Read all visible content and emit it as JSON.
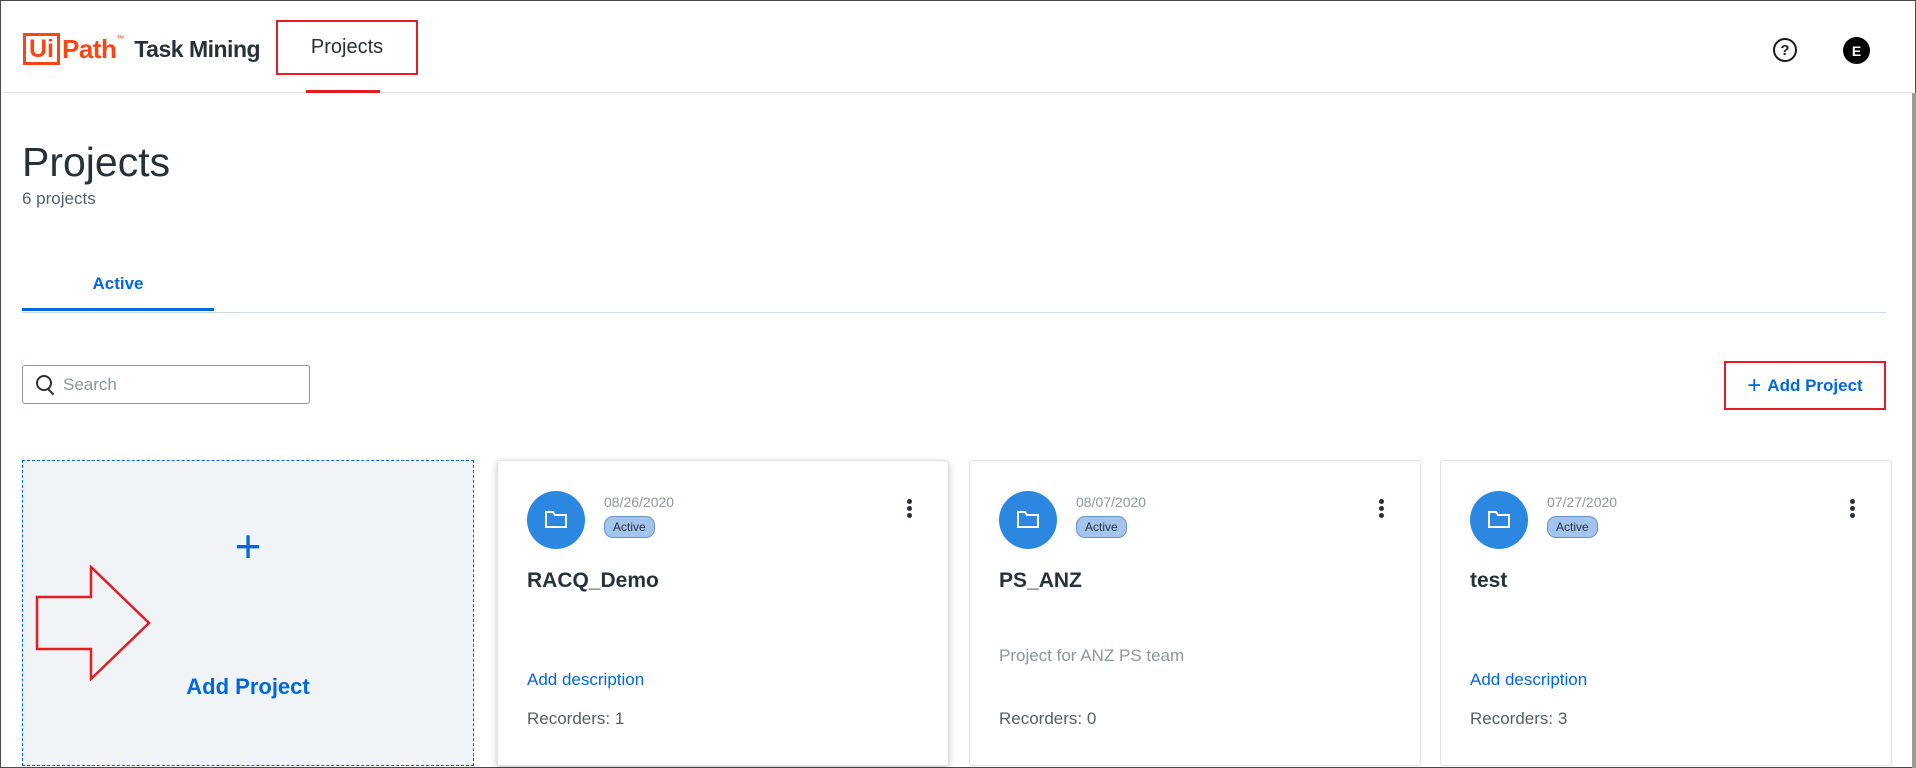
{
  "header": {
    "logo_ui": "Ui",
    "logo_path": "Path",
    "logo_tm": "™",
    "product_name": "Task Mining",
    "nav_projects": "Projects",
    "help_symbol": "?",
    "avatar_initial": "E"
  },
  "page": {
    "title": "Projects",
    "count": "6 projects",
    "tabs": [
      {
        "label": "Active"
      }
    ]
  },
  "search": {
    "placeholder": "Search",
    "value": ""
  },
  "toolbar": {
    "add_project_plus": "+",
    "add_project_label": "Add Project"
  },
  "add_card": {
    "plus": "+",
    "label": "Add Project"
  },
  "projects": [
    {
      "date": "08/26/2020",
      "status": "Active",
      "name": "RACQ_Demo",
      "description": "",
      "add_description_label": "Add description",
      "recorders": "Recorders: 1"
    },
    {
      "date": "08/07/2020",
      "status": "Active",
      "name": "PS_ANZ",
      "description": "Project for ANZ PS team",
      "add_description_label": "",
      "recorders": "Recorders: 0"
    },
    {
      "date": "07/27/2020",
      "status": "Active",
      "name": "test",
      "description": "",
      "add_description_label": "Add description",
      "recorders": "Recorders: 3"
    }
  ],
  "colors": {
    "brand": "#fa4616",
    "accent": "#0067df",
    "highlight": "#e21d24",
    "folder": "#2c87e0"
  },
  "icons": [
    "search-icon",
    "help-icon",
    "folder-icon",
    "more-vertical-icon",
    "plus-icon",
    "arrow-right-icon"
  ]
}
